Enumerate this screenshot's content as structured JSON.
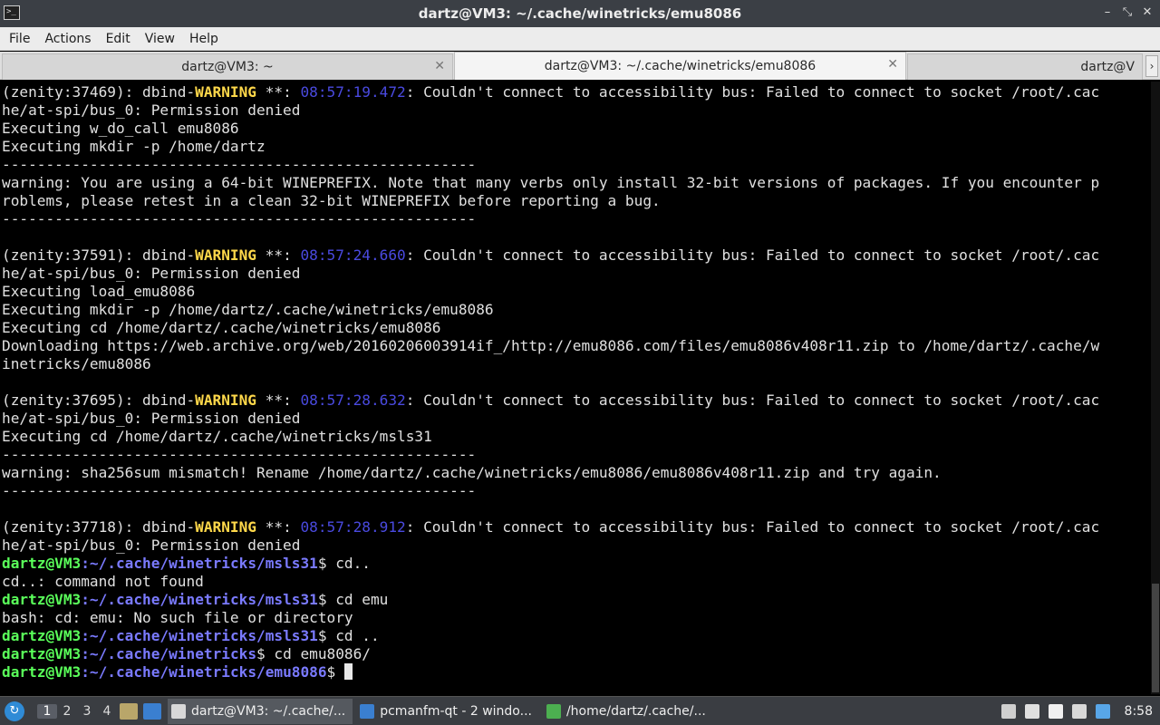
{
  "window": {
    "title": "dartz@VM3: ~/.cache/winetricks/emu8086",
    "app_icon": "terminal-icon",
    "controls": {
      "minimize": "–",
      "restore": "⤡",
      "close": "✕"
    }
  },
  "menu": [
    "File",
    "Actions",
    "Edit",
    "View",
    "Help"
  ],
  "tabs": [
    {
      "label": "dartz@VM3: ~",
      "close": "✕"
    },
    {
      "label": "dartz@VM3: ~/.cache/winetricks/emu8086",
      "close": "✕"
    },
    {
      "label": "dartz@V"
    }
  ],
  "tab_scroll": "›",
  "terminal": {
    "lines": [
      [
        {
          "t": "(zenity:37469): dbind-"
        },
        {
          "t": "WARNING",
          "c": "warn"
        },
        {
          "t": " **: "
        },
        {
          "t": "08:57:19.472",
          "c": "ts"
        },
        {
          "t": ": Couldn't connect to accessibility bus: Failed to connect to socket /root/.cac"
        }
      ],
      [
        {
          "t": "he/at-spi/bus_0: Permission denied"
        }
      ],
      [
        {
          "t": "Executing w_do_call emu8086"
        }
      ],
      [
        {
          "t": "Executing mkdir -p /home/dartz"
        }
      ],
      [
        {
          "t": "------------------------------------------------------"
        }
      ],
      [
        {
          "t": "warning: You are using a 64-bit WINEPREFIX. Note that many verbs only install 32-bit versions of packages. If you encounter p"
        }
      ],
      [
        {
          "t": "roblems, please retest in a clean 32-bit WINEPREFIX before reporting a bug."
        }
      ],
      [
        {
          "t": "------------------------------------------------------"
        }
      ],
      [
        {
          "t": ""
        }
      ],
      [
        {
          "t": "(zenity:37591): dbind-"
        },
        {
          "t": "WARNING",
          "c": "warn"
        },
        {
          "t": " **: "
        },
        {
          "t": "08:57:24.660",
          "c": "ts"
        },
        {
          "t": ": Couldn't connect to accessibility bus: Failed to connect to socket /root/.cac"
        }
      ],
      [
        {
          "t": "he/at-spi/bus_0: Permission denied"
        }
      ],
      [
        {
          "t": "Executing load_emu8086"
        }
      ],
      [
        {
          "t": "Executing mkdir -p /home/dartz/.cache/winetricks/emu8086"
        }
      ],
      [
        {
          "t": "Executing cd /home/dartz/.cache/winetricks/emu8086"
        }
      ],
      [
        {
          "t": "Downloading https://web.archive.org/web/20160206003914if_/http://emu8086.com/files/emu8086v408r11.zip to /home/dartz/.cache/w"
        }
      ],
      [
        {
          "t": "inetricks/emu8086"
        }
      ],
      [
        {
          "t": ""
        }
      ],
      [
        {
          "t": "(zenity:37695): dbind-"
        },
        {
          "t": "WARNING",
          "c": "warn"
        },
        {
          "t": " **: "
        },
        {
          "t": "08:57:28.632",
          "c": "ts"
        },
        {
          "t": ": Couldn't connect to accessibility bus: Failed to connect to socket /root/.cac"
        }
      ],
      [
        {
          "t": "he/at-spi/bus_0: Permission denied"
        }
      ],
      [
        {
          "t": "Executing cd /home/dartz/.cache/winetricks/msls31"
        }
      ],
      [
        {
          "t": "------------------------------------------------------"
        }
      ],
      [
        {
          "t": "warning: sha256sum mismatch! Rename /home/dartz/.cache/winetricks/emu8086/emu8086v408r11.zip and try again."
        }
      ],
      [
        {
          "t": "------------------------------------------------------"
        }
      ],
      [
        {
          "t": ""
        }
      ],
      [
        {
          "t": "(zenity:37718): dbind-"
        },
        {
          "t": "WARNING",
          "c": "warn"
        },
        {
          "t": " **: "
        },
        {
          "t": "08:57:28.912",
          "c": "ts"
        },
        {
          "t": ": Couldn't connect to accessibility bus: Failed to connect to socket /root/.cac"
        }
      ],
      [
        {
          "t": "he/at-spi/bus_0: Permission denied"
        }
      ],
      [
        {
          "t": "dartz@VM3",
          "c": "pu"
        },
        {
          "t": ":",
          "c": "pp"
        },
        {
          "t": "~/.cache/winetricks/msls31",
          "c": "pp"
        },
        {
          "t": "$ cd.."
        }
      ],
      [
        {
          "t": "cd..: command not found"
        }
      ],
      [
        {
          "t": "dartz@VM3",
          "c": "pu"
        },
        {
          "t": ":",
          "c": "pp"
        },
        {
          "t": "~/.cache/winetricks/msls31",
          "c": "pp"
        },
        {
          "t": "$ cd emu"
        }
      ],
      [
        {
          "t": "bash: cd: emu: No such file or directory"
        }
      ],
      [
        {
          "t": "dartz@VM3",
          "c": "pu"
        },
        {
          "t": ":",
          "c": "pp"
        },
        {
          "t": "~/.cache/winetricks/msls31",
          "c": "pp"
        },
        {
          "t": "$ cd .."
        }
      ],
      [
        {
          "t": "dartz@VM3",
          "c": "pu"
        },
        {
          "t": ":",
          "c": "pp"
        },
        {
          "t": "~/.cache/winetricks",
          "c": "pp"
        },
        {
          "t": "$ cd emu8086/"
        }
      ],
      [
        {
          "t": "dartz@VM3",
          "c": "pu"
        },
        {
          "t": ":",
          "c": "pp"
        },
        {
          "t": "~/.cache/winetricks/emu8086",
          "c": "pp"
        },
        {
          "t": "$ "
        },
        {
          "cursor": true
        }
      ]
    ]
  },
  "taskbar": {
    "desktops": [
      "1",
      "2",
      "3",
      "4"
    ],
    "active_desktop": "1",
    "launchers": [
      {
        "icon": "show-desktop-icon",
        "color": "#b9a66a"
      },
      {
        "icon": "file-manager-icon",
        "color": "#3a7fd0"
      }
    ],
    "tasks": [
      {
        "label": "dartz@VM3: ~/.cache/...",
        "icon": "terminal-icon",
        "color": "#d8d8d8",
        "active": true
      },
      {
        "label": "pcmanfm-qt - 2 windo...",
        "icon": "folder-icon",
        "color": "#3a7fd0",
        "active": false
      },
      {
        "label": "/home/dartz/.cache/...",
        "icon": "archive-icon",
        "color": "#4caf50",
        "active": false
      }
    ],
    "tray": [
      {
        "icon": "trash-icon",
        "color": "#cfcfcf"
      },
      {
        "icon": "volume-icon",
        "color": "#e0e0e0"
      },
      {
        "icon": "clipboard-icon",
        "color": "#f0f0f0"
      },
      {
        "icon": "network-icon",
        "color": "#d8d8d8"
      },
      {
        "icon": "update-icon",
        "color": "#58a6e8"
      }
    ],
    "clock": "8:58",
    "start_glyph": "↻"
  }
}
